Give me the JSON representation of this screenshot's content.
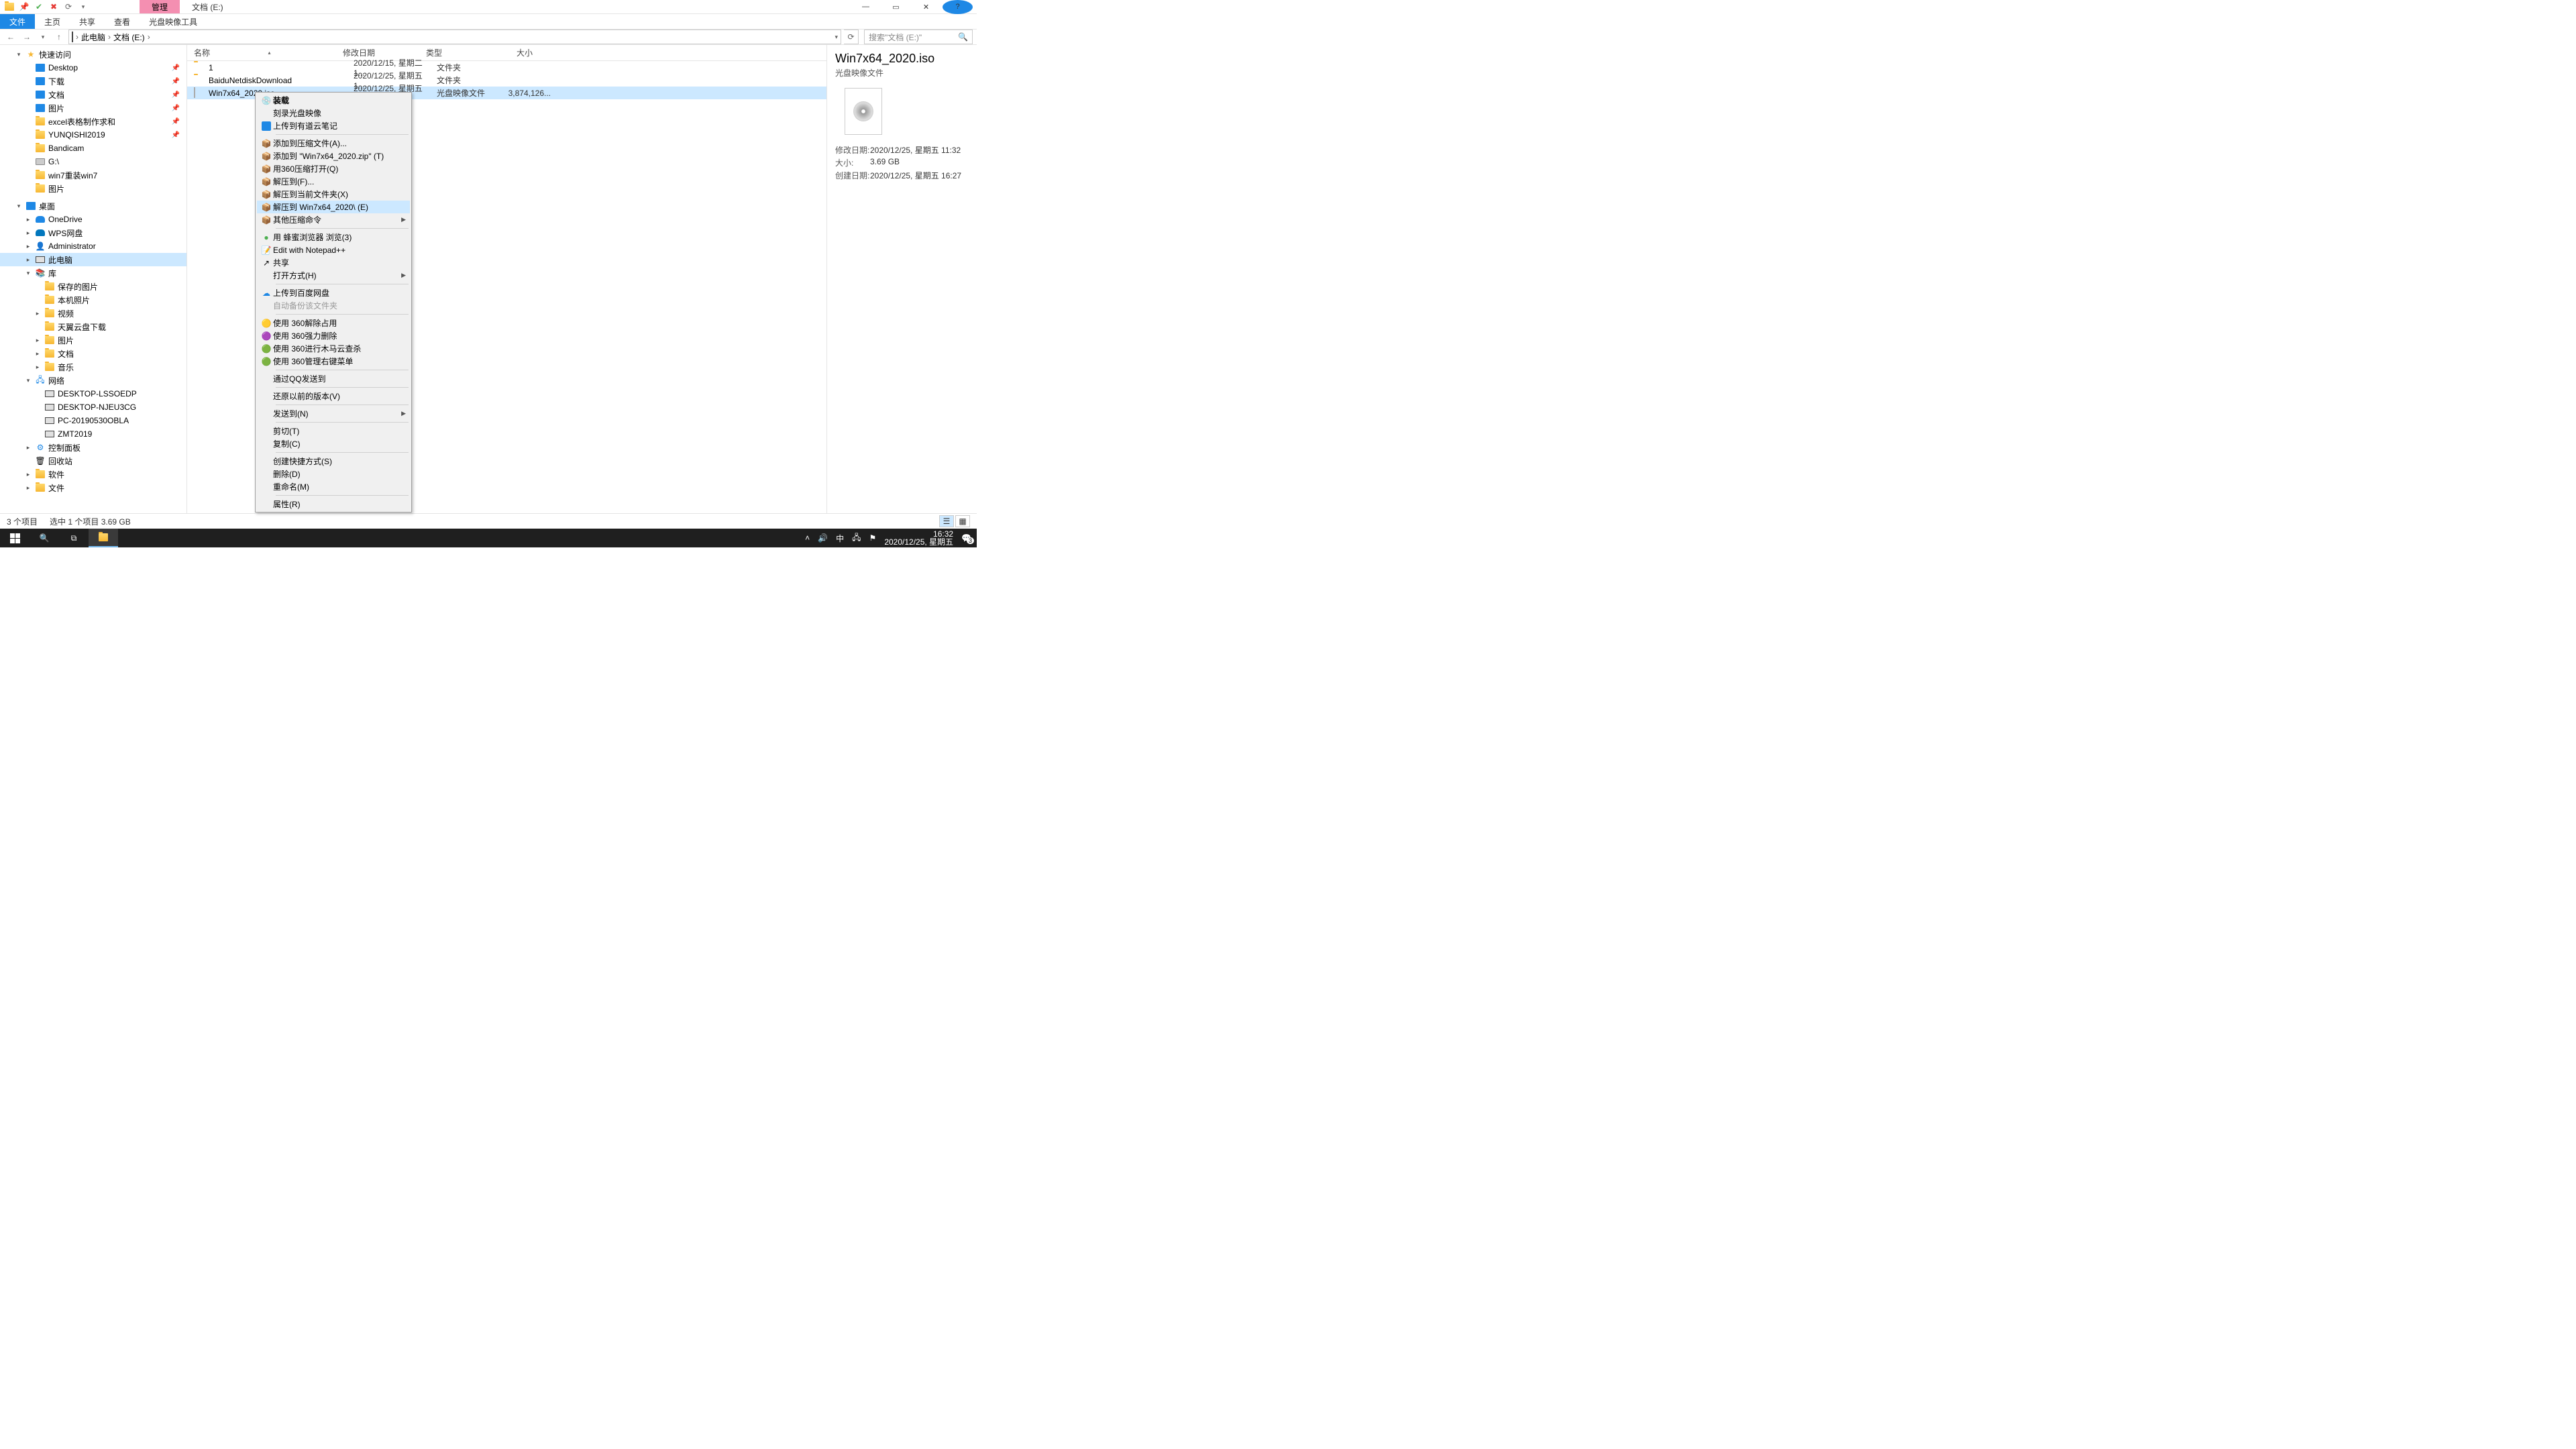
{
  "title": {
    "manage": "管理",
    "location": "文档 (E:)"
  },
  "ribbon": {
    "file": "文件",
    "home": "主页",
    "share": "共享",
    "view": "查看",
    "disc": "光盘映像工具"
  },
  "nav": {
    "back": "←",
    "fwd": "→",
    "up": "↑"
  },
  "breadcrumb": {
    "root": "此电脑",
    "folder": "文档 (E:)"
  },
  "search": {
    "placeholder": "搜索\"文档 (E:)\""
  },
  "tree": {
    "quick": "快速访问",
    "desktop": "Desktop",
    "downloads": "下载",
    "documents": "文档",
    "pictures": "图片",
    "excel": "excel表格制作求和",
    "yunqishi": "YUNQISHI2019",
    "bandicam": "Bandicam",
    "gdrive": "G:\\",
    "win7": "win7重装win7",
    "pictures2": "图片",
    "desktop2": "桌面",
    "onedrive": "OneDrive",
    "wps": "WPS网盘",
    "admin": "Administrator",
    "thispc": "此电脑",
    "libraries": "库",
    "saved": "保存的图片",
    "camera": "本机照片",
    "videos": "视频",
    "tianyi": "天翼云盘下载",
    "pictures3": "图片",
    "documents2": "文档",
    "music": "音乐",
    "network": "网络",
    "pc1": "DESKTOP-LSSOEDP",
    "pc2": "DESKTOP-NJEU3CG",
    "pc3": "PC-20190530OBLA",
    "pc4": "ZMT2019",
    "ctrl": "控制面板",
    "recycle": "回收站",
    "soft": "软件",
    "files": "文件"
  },
  "cols": {
    "name": "名称",
    "date": "修改日期",
    "type": "类型",
    "size": "大小"
  },
  "rows": [
    {
      "name": "1",
      "date": "2020/12/15, 星期二 1...",
      "type": "文件夹",
      "size": ""
    },
    {
      "name": "BaiduNetdiskDownload",
      "date": "2020/12/25, 星期五 1...",
      "type": "文件夹",
      "size": ""
    },
    {
      "name": "Win7x64_2020.iso",
      "date": "2020/12/25, 星期五 1...",
      "type": "光盘映像文件",
      "size": "3,874,126..."
    }
  ],
  "ctx": {
    "mount": "装载",
    "burn": "刻录光盘映像",
    "youdao": "上传到有道云笔记",
    "addarc": "添加到压缩文件(A)...",
    "addzip": "添加到 \"Win7x64_2020.zip\" (T)",
    "open360": "用360压缩打开(Q)",
    "extractf": "解压到(F)...",
    "extractcur": "解压到当前文件夹(X)",
    "extractto": "解压到 Win7x64_2020\\ (E)",
    "other": "其他压缩命令",
    "browse": "用 蜂蜜浏览器 浏览(3)",
    "npp": "Edit with Notepad++",
    "share": "共享",
    "openwith": "打开方式(H)",
    "baidu": "上传到百度网盘",
    "autobak": "自动备份该文件夹",
    "s360_1": "使用 360解除占用",
    "s360_2": "使用 360强力删除",
    "s360_3": "使用 360进行木马云查杀",
    "s360_4": "使用 360管理右键菜单",
    "qq": "通过QQ发送到",
    "restore": "还原以前的版本(V)",
    "sendto": "发送到(N)",
    "cut": "剪切(T)",
    "copy": "复制(C)",
    "shortcut": "创建快捷方式(S)",
    "delete": "删除(D)",
    "rename": "重命名(M)",
    "props": "属性(R)"
  },
  "preview": {
    "name": "Win7x64_2020.iso",
    "type": "光盘映像文件",
    "k1": "修改日期:",
    "v1": "2020/12/25, 星期五 11:32",
    "k2": "大小:",
    "v2": "3.69 GB",
    "k3": "创建日期:",
    "v3": "2020/12/25, 星期五 16:27"
  },
  "status": {
    "count": "3 个项目",
    "sel": "选中 1 个项目  3.69 GB"
  },
  "tray": {
    "ime": "中",
    "time": "16:32",
    "date": "2020/12/25, 星期五",
    "badge": "3"
  }
}
